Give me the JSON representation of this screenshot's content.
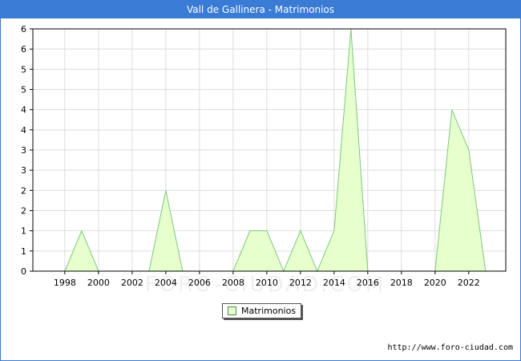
{
  "window": {
    "title": "Vall de Gallinera - Matrimonios"
  },
  "watermark": "FORO-CIUDAD.COM",
  "source_url": "http://www.foro-ciudad.com",
  "colors": {
    "fill": "#e6ffcc",
    "line": "#7ec97e",
    "title_bar": "#3a7bd5",
    "grid": "#dddddd"
  },
  "chart_data": {
    "type": "area",
    "title": "Vall de Gallinera - Matrimonios",
    "x": [
      1998,
      1999,
      2000,
      2001,
      2002,
      2003,
      2004,
      2005,
      2006,
      2007,
      2008,
      2009,
      2010,
      2011,
      2012,
      2013,
      2014,
      2015,
      2016,
      2017,
      2018,
      2019,
      2020,
      2021,
      2022,
      2023
    ],
    "series": [
      {
        "name": "Matrimonios",
        "values": [
          0,
          1,
          0,
          0,
          0,
          0,
          2,
          0,
          0,
          0,
          0,
          1,
          1,
          0,
          1,
          0,
          1,
          6,
          0,
          0,
          0,
          0,
          0,
          4,
          3,
          0
        ]
      }
    ],
    "x_ticks": [
      "1998",
      "2000",
      "2002",
      "2004",
      "2006",
      "2008",
      "2010",
      "2012",
      "2014",
      "2016",
      "2018",
      "2020",
      "2022"
    ],
    "x_tick_values": [
      1998,
      2000,
      2002,
      2004,
      2006,
      2008,
      2010,
      2012,
      2014,
      2016,
      2018,
      2020,
      2022
    ],
    "y_ticks": [
      "0",
      "1",
      "1",
      "2",
      "2",
      "3",
      "3",
      "4",
      "4",
      "5",
      "5",
      "6",
      "6"
    ],
    "y_tick_values": [
      0,
      0.5,
      1,
      1.5,
      2,
      2.5,
      3,
      3.5,
      4,
      4.5,
      5,
      5.5,
      6
    ],
    "xlim": [
      1996.1,
      2024.2
    ],
    "ylim": [
      0,
      6
    ],
    "grid": true,
    "legend_position": "bottom-center"
  }
}
